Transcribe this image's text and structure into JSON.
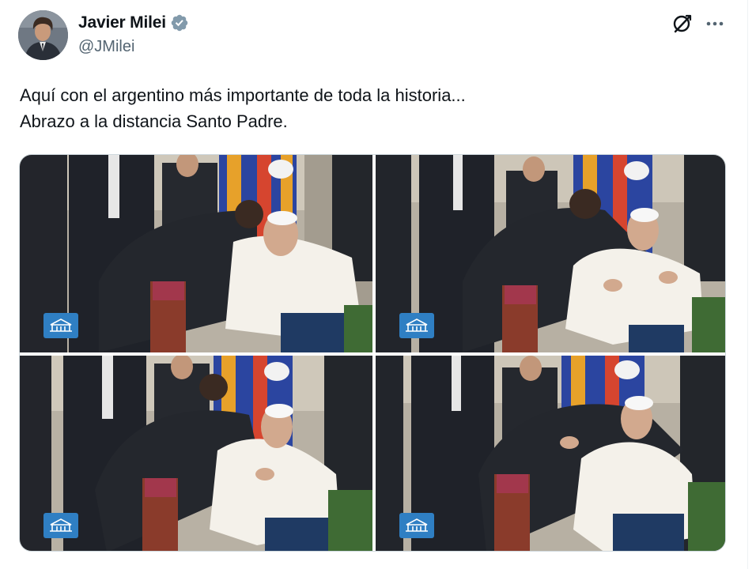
{
  "author": {
    "display_name": "Javier Milei",
    "handle": "@JMilei",
    "verified": true,
    "avatar_icon": "profile-avatar"
  },
  "actions": {
    "grok_icon": "grok-icon",
    "more_icon": "more-dots-icon"
  },
  "tweet": {
    "lines": [
      "Aquí con el argentino más importante de toda la historia...",
      "Abrazo a la distancia Santo Padre."
    ]
  },
  "media": {
    "count": 4,
    "badge_icon": "vatican-media-logo",
    "photos": [
      {
        "name": "photo-1",
        "scene": "bow-greeting"
      },
      {
        "name": "photo-2",
        "scene": "embrace-hands"
      },
      {
        "name": "photo-3",
        "scene": "bow-greeting"
      },
      {
        "name": "photo-4",
        "scene": "embrace"
      }
    ]
  },
  "colors": {
    "verified_blue": "#1d9bf0",
    "text_primary": "#0f1419",
    "text_secondary": "#536471",
    "badge_blue": "#2f7fc3"
  }
}
